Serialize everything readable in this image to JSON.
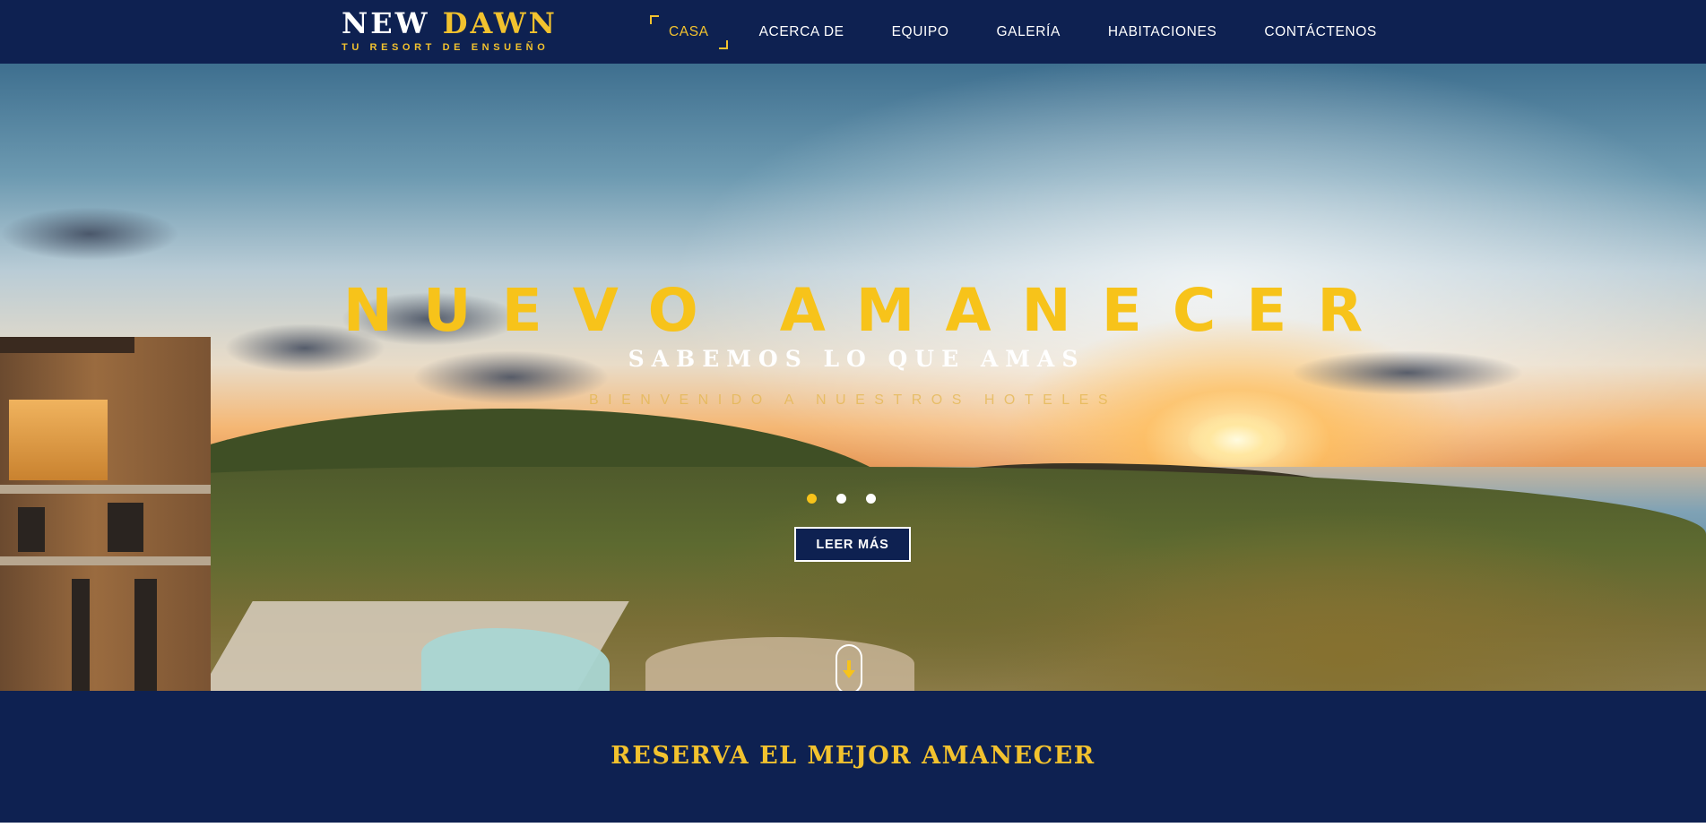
{
  "brand": {
    "word1": "NEW",
    "word2": "DAWN",
    "tagline": "TU RESORT DE ENSUEÑO",
    "colors": {
      "navy": "#0e2151",
      "gold": "#f2c22e",
      "white": "#ffffff"
    }
  },
  "nav": {
    "items": [
      {
        "label": "CASA",
        "active": true
      },
      {
        "label": "ACERCA DE",
        "active": false
      },
      {
        "label": "EQUIPO",
        "active": false
      },
      {
        "label": "GALERÍA",
        "active": false
      },
      {
        "label": "HABITACIONES",
        "active": false
      },
      {
        "label": "CONTÁCTENOS",
        "active": false
      }
    ]
  },
  "hero": {
    "title": "NUEVO AMANECER",
    "subtitle": "SABEMOS LO QUE AMAS",
    "welcome": "BIENVENIDO A NUESTROS HOTELES",
    "slides": {
      "count": 3,
      "active_index": 0
    },
    "cta_label": "LEER MÁS",
    "scroll_icon": "arrow-down-icon"
  },
  "booking": {
    "title": "RESERVA EL MEJOR AMANECER"
  }
}
